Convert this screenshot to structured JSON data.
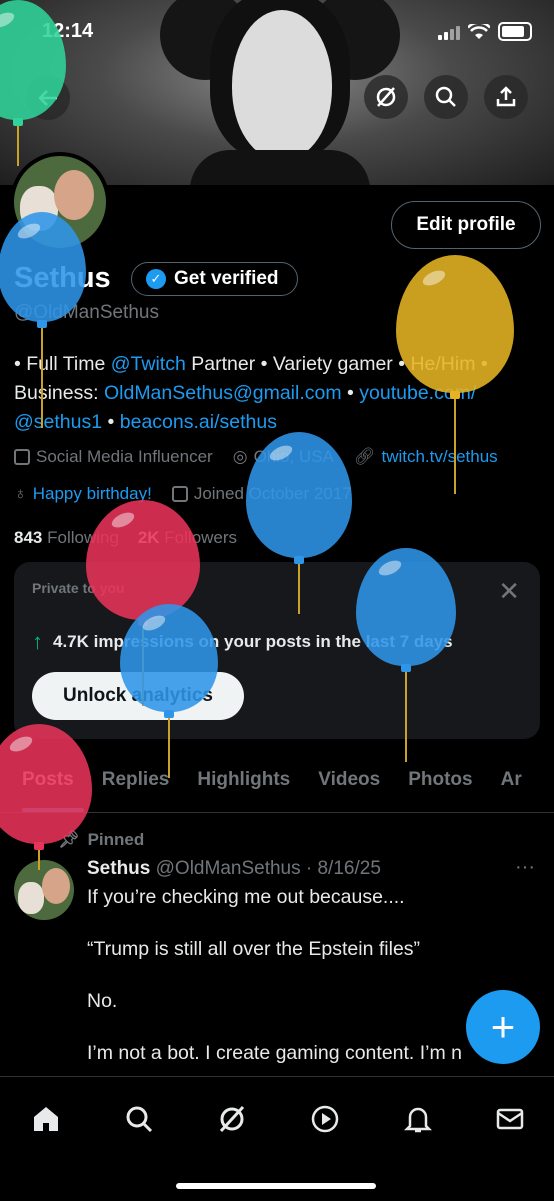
{
  "status_bar": {
    "time": "12:14"
  },
  "profile": {
    "name": "Sethus",
    "get_verified": "Get verified",
    "handle": "@OldManSethus",
    "edit_profile": "Edit profile",
    "bio_1": "• Full Time ",
    "bio_twitch": "@Twitch",
    "bio_2": " Partner • Variety gamer • He/Him •",
    "bio_3": "Business: ",
    "bio_email": "OldManSethus@gmail.com",
    "bio_4": " • ",
    "bio_youtube": "youtube.com/",
    "bio_youtube_2": "@sethus1",
    "bio_5": " • ",
    "bio_beacons": "beacons.ai/sethus",
    "category": "Social Media Influencer",
    "location": "Ohio, USA",
    "website": "twitch.tv/sethus",
    "birthday": "Happy birthday!",
    "joined": "Joined October 2017",
    "following_count": "843",
    "following_label": "Following",
    "followers_count": "2K",
    "followers_label": "Followers"
  },
  "analytics": {
    "private_label": "Private to you",
    "impressions_value": "4.7K",
    "impressions_text": "impressions on your posts in the last 7 days",
    "unlock_label": "Unlock analytics"
  },
  "tabs": [
    {
      "label": "Posts"
    },
    {
      "label": "Replies"
    },
    {
      "label": "Highlights"
    },
    {
      "label": "Videos"
    },
    {
      "label": "Photos"
    },
    {
      "label": "Ar"
    }
  ],
  "post": {
    "pinned_label": "Pinned",
    "author": "Sethus",
    "handle_date": "@OldManSethus · 8/16/25",
    "more": "···",
    "line1": "If you’re checking me out because....",
    "line2": "“Trump is still all over the Epstein files”",
    "line3": "No.",
    "line4": "I’m not a bot. I create gaming content. I’m n"
  },
  "fab_label": "+",
  "icons": {
    "back": "back-arrow-icon",
    "grok": "grok-icon",
    "search": "search-icon",
    "share": "share-icon",
    "home": "home-icon",
    "explore": "search-icon",
    "grok_nav": "grok-icon",
    "video": "play-icon",
    "notifications": "bell-icon",
    "messages": "mail-icon"
  },
  "colors": {
    "accent": "#1d9bf0",
    "growth": "#00ba7c",
    "balloon_blue": "#2f95e8",
    "balloon_red": "#e8335a",
    "balloon_green": "#2fd49a",
    "balloon_yellow": "#e6b422"
  }
}
